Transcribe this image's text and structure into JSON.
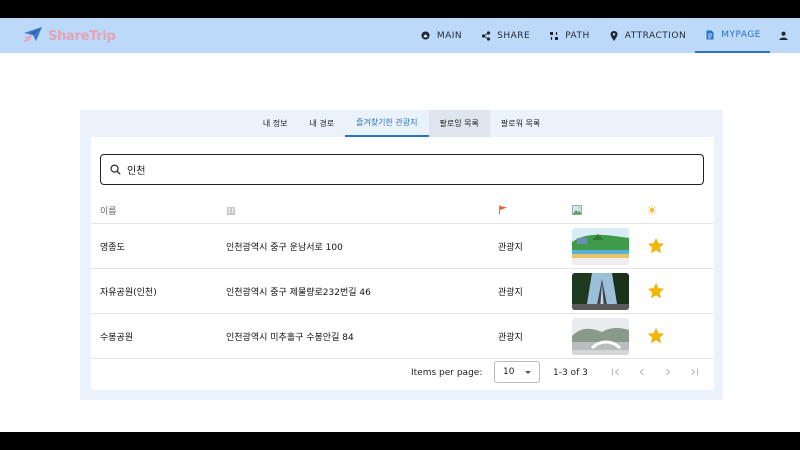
{
  "app": {
    "logo_text": "ShareTrip"
  },
  "nav": [
    {
      "label": "MAIN",
      "icon": "home-icon"
    },
    {
      "label": "SHARE",
      "icon": "share-icon"
    },
    {
      "label": "PATH",
      "icon": "path-icon"
    },
    {
      "label": "ATTRACTION",
      "icon": "pin-icon"
    },
    {
      "label": "MYPAGE",
      "icon": "document-icon",
      "active": true
    },
    {
      "label": "",
      "icon": "user-icon"
    }
  ],
  "tabs": [
    {
      "label": "내 정보"
    },
    {
      "label": "내 경로"
    },
    {
      "label": "즐겨찾기한 관광지",
      "active": true
    },
    {
      "label": "팔로잉 목록"
    },
    {
      "label": "팔로워 목록"
    }
  ],
  "search": {
    "value": "인천"
  },
  "table": {
    "headers": {
      "name": "이름",
      "address_icon": "building-icon",
      "type_icon": "flag-icon",
      "image_icon": "picture-icon",
      "fav_icon": "sun-icon"
    },
    "rows": [
      {
        "name": "영종도",
        "address": "인천광역시 중구 운남서로 100",
        "type": "관광지",
        "image": "coast-photo",
        "favorite": true
      },
      {
        "name": "자유공원(인천)",
        "address": "인천광역시 중구 제물량로232번길 46",
        "type": "관광지",
        "image": "monument-photo",
        "favorite": true
      },
      {
        "name": "수봉공원",
        "address": "인천광역시 미추홀구 수봉안길 84",
        "type": "관광지",
        "image": "park-photo",
        "favorite": true
      }
    ]
  },
  "pagination": {
    "label": "Items per page:",
    "per_page": "10",
    "range": "1-3 of 3"
  },
  "colors": {
    "navbar": "#bcd9f9",
    "accent": "#2a73c4",
    "star": "#f5b800",
    "card": "#eaf3fc"
  }
}
